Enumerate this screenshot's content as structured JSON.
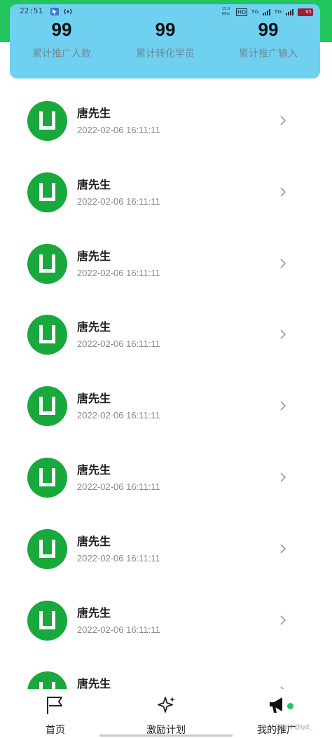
{
  "status_bar": {
    "time": "22:51",
    "net_speed": "15.0 KB/s",
    "hd": "HD",
    "net1": "5G",
    "net2": "5G",
    "battery": "85"
  },
  "stats": [
    {
      "value": "99",
      "label": "累计推广人数"
    },
    {
      "value": "99",
      "label": "累计转化学员"
    },
    {
      "value": "99",
      "label": "累计推广输入"
    }
  ],
  "list": [
    {
      "name": "唐先生",
      "date": "2022-02-06 16:11:11"
    },
    {
      "name": "唐先生",
      "date": "2022-02-06 16:11:11"
    },
    {
      "name": "唐先生",
      "date": "2022-02-06 16:11:11"
    },
    {
      "name": "唐先生",
      "date": "2022-02-06 16:11:11"
    },
    {
      "name": "唐先生",
      "date": "2022-02-06 16:11:11"
    },
    {
      "name": "唐先生",
      "date": "2022-02-06 16:11:11"
    },
    {
      "name": "唐先生",
      "date": "2022-02-06 16:11:11"
    },
    {
      "name": "唐先生",
      "date": "2022-02-06 16:11:11"
    },
    {
      "name": "唐先生",
      "date": ""
    }
  ],
  "tabbar": {
    "tabs": [
      {
        "label": "首页",
        "icon": "flag-icon"
      },
      {
        "label": "激励计划",
        "icon": "sparkle-icon"
      },
      {
        "label": "我的推广",
        "icon": "megaphone-icon"
      }
    ]
  },
  "watermark": "CSDN @tyd_",
  "colors": {
    "header_green": "#22c55e",
    "stats_card": "#6fd0f0",
    "avatar_green": "#18a83c"
  }
}
